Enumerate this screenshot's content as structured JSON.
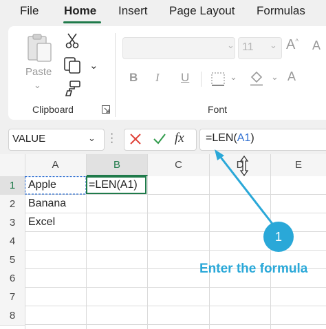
{
  "ribbon_tabs": [
    "File",
    "Home",
    "Insert",
    "Page Layout",
    "Formulas"
  ],
  "active_tab": "Home",
  "clipboard": {
    "paste_label": "Paste",
    "group_label": "Clipboard"
  },
  "font_group": {
    "font_size": "11",
    "group_label": "Font",
    "bold": "B",
    "italic": "I",
    "underline": "U"
  },
  "formula_bar": {
    "name_box": "VALUE",
    "fx_label": "fx",
    "formula_prefix": "=LEN(",
    "formula_ref": "A1",
    "formula_suffix": ")"
  },
  "columns": [
    "A",
    "B",
    "C",
    "D",
    "E"
  ],
  "rows": [
    "1",
    "2",
    "3",
    "4",
    "5",
    "6",
    "7",
    "8"
  ],
  "cells": {
    "A1": "Apple",
    "A2": "Banana",
    "A3": "Excel",
    "B1": "=LEN(A1)"
  },
  "annotation": {
    "step": "1",
    "caption": "Enter the formula"
  },
  "colors": {
    "accent": "#1f7a4a",
    "annotation": "#2aa8d8",
    "reference": "#2f6fd1"
  }
}
